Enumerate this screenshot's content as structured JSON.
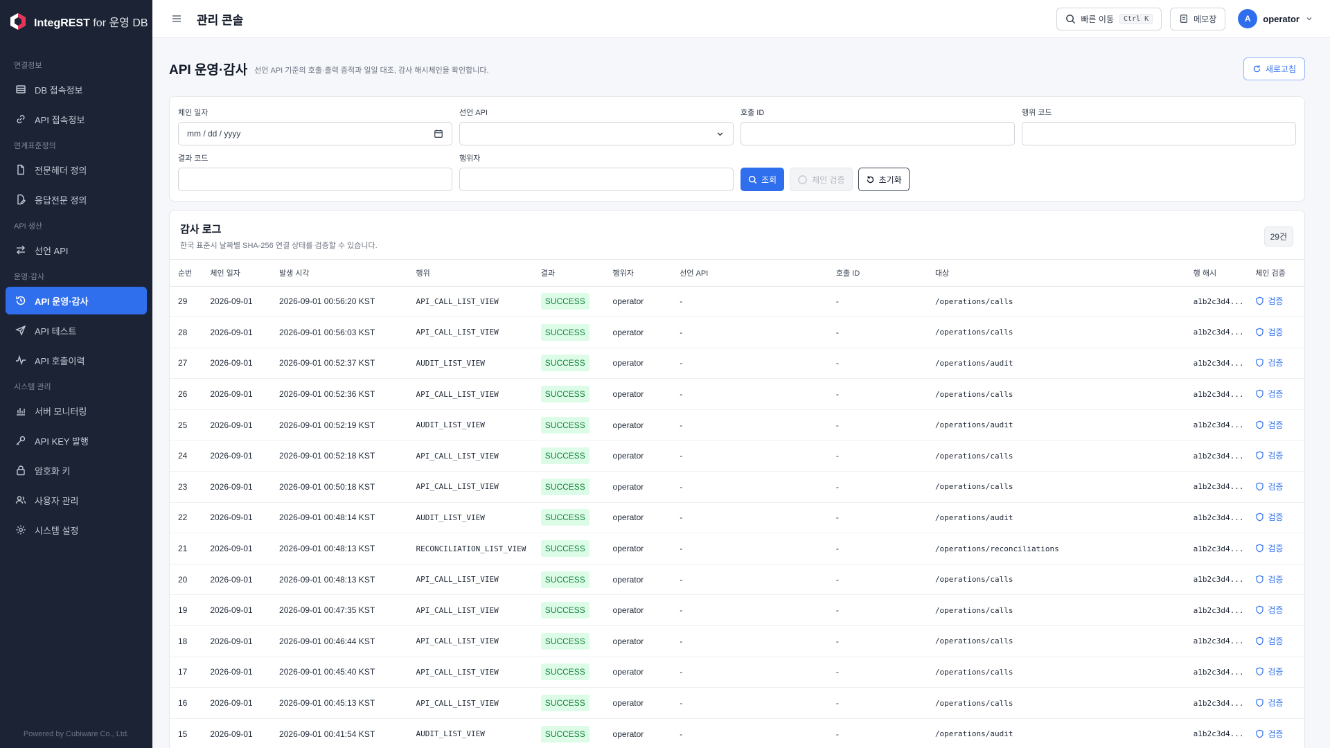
{
  "brand": {
    "name": "IntegREST",
    "suffix": "for 운영 DB"
  },
  "sidebar": {
    "sections": [
      {
        "title": "연결정보",
        "items": [
          {
            "label": "DB 접속정보",
            "icon": "database-icon"
          },
          {
            "label": "API 접속정보",
            "icon": "link-icon"
          }
        ]
      },
      {
        "title": "연계표준정의",
        "items": [
          {
            "label": "전문헤더 정의",
            "icon": "file-icon"
          },
          {
            "label": "응답전문 정의",
            "icon": "file-edit-icon"
          }
        ]
      },
      {
        "title": "API 생산",
        "items": [
          {
            "label": "선언 API",
            "icon": "arrows-icon"
          }
        ]
      },
      {
        "title": "운영·감사",
        "items": [
          {
            "label": "API 운영·감사",
            "icon": "history-icon",
            "active": true
          },
          {
            "label": "API 테스트",
            "icon": "send-icon"
          },
          {
            "label": "API 호출이력",
            "icon": "activity-icon"
          }
        ]
      },
      {
        "title": "시스템 관리",
        "items": [
          {
            "label": "서버 모니터링",
            "icon": "bar-chart-icon"
          },
          {
            "label": "API KEY 발행",
            "icon": "key-icon"
          },
          {
            "label": "암호화 키",
            "icon": "lock-icon"
          },
          {
            "label": "사용자 관리",
            "icon": "users-icon"
          },
          {
            "label": "시스템 설정",
            "icon": "gear-icon"
          }
        ]
      }
    ],
    "footer": "Powered by Cubiware Co., Ltd."
  },
  "topbar": {
    "title": "관리 콘솔",
    "quick_label": "빠른 이동",
    "quick_kbd": "Ctrl K",
    "memo_label": "메모장",
    "user_initial": "A",
    "user_name": "operator"
  },
  "page": {
    "title": "API 운영·감사",
    "subtitle": "선언 API 기준의 호출·출력 증적과 일일 대조, 감사 해시체인을 확인합니다.",
    "refresh_label": "새로고침"
  },
  "filters": {
    "chain_date_label": "체인 일자",
    "chain_date_placeholder": "mm / dd / yyyy",
    "api_label": "선언 API",
    "api_value": "",
    "call_id_label": "호출 ID",
    "action_code_label": "행위 코드",
    "result_code_label": "결과 코드",
    "actor_label": "행위자",
    "search_label": "조회",
    "verify_label": "체인 검증",
    "reset_label": "초기화"
  },
  "log": {
    "title": "감사 로그",
    "subtitle": "한국 표준시 날짜별 SHA-256 연결 상태를 검증할 수 있습니다.",
    "count": "29건",
    "columns": [
      "순번",
      "체인 일자",
      "발생 시각",
      "행위",
      "결과",
      "행위자",
      "선언 API",
      "호출 ID",
      "대상",
      "행 해시",
      "체인 검증"
    ],
    "verify_label": "검증",
    "rows": [
      {
        "seq": "29",
        "date": "2026-09-01",
        "time": "2026-09-01 00:56:20 KST",
        "action": "API_CALL_LIST_VIEW",
        "result": "SUCCESS",
        "actor": "operator",
        "api": "-",
        "call_id": "-",
        "target": "/operations/calls",
        "hash": "a1b2c3d4..."
      },
      {
        "seq": "28",
        "date": "2026-09-01",
        "time": "2026-09-01 00:56:03 KST",
        "action": "API_CALL_LIST_VIEW",
        "result": "SUCCESS",
        "actor": "operator",
        "api": "-",
        "call_id": "-",
        "target": "/operations/calls",
        "hash": "a1b2c3d4..."
      },
      {
        "seq": "27",
        "date": "2026-09-01",
        "time": "2026-09-01 00:52:37 KST",
        "action": "AUDIT_LIST_VIEW",
        "result": "SUCCESS",
        "actor": "operator",
        "api": "-",
        "call_id": "-",
        "target": "/operations/audit",
        "hash": "a1b2c3d4..."
      },
      {
        "seq": "26",
        "date": "2026-09-01",
        "time": "2026-09-01 00:52:36 KST",
        "action": "API_CALL_LIST_VIEW",
        "result": "SUCCESS",
        "actor": "operator",
        "api": "-",
        "call_id": "-",
        "target": "/operations/calls",
        "hash": "a1b2c3d4..."
      },
      {
        "seq": "25",
        "date": "2026-09-01",
        "time": "2026-09-01 00:52:19 KST",
        "action": "AUDIT_LIST_VIEW",
        "result": "SUCCESS",
        "actor": "operator",
        "api": "-",
        "call_id": "-",
        "target": "/operations/audit",
        "hash": "a1b2c3d4..."
      },
      {
        "seq": "24",
        "date": "2026-09-01",
        "time": "2026-09-01 00:52:18 KST",
        "action": "API_CALL_LIST_VIEW",
        "result": "SUCCESS",
        "actor": "operator",
        "api": "-",
        "call_id": "-",
        "target": "/operations/calls",
        "hash": "a1b2c3d4..."
      },
      {
        "seq": "23",
        "date": "2026-09-01",
        "time": "2026-09-01 00:50:18 KST",
        "action": "API_CALL_LIST_VIEW",
        "result": "SUCCESS",
        "actor": "operator",
        "api": "-",
        "call_id": "-",
        "target": "/operations/calls",
        "hash": "a1b2c3d4..."
      },
      {
        "seq": "22",
        "date": "2026-09-01",
        "time": "2026-09-01 00:48:14 KST",
        "action": "AUDIT_LIST_VIEW",
        "result": "SUCCESS",
        "actor": "operator",
        "api": "-",
        "call_id": "-",
        "target": "/operations/audit",
        "hash": "a1b2c3d4..."
      },
      {
        "seq": "21",
        "date": "2026-09-01",
        "time": "2026-09-01 00:48:13 KST",
        "action": "RECONCILIATION_LIST_VIEW",
        "result": "SUCCESS",
        "actor": "operator",
        "api": "-",
        "call_id": "-",
        "target": "/operations/reconciliations",
        "hash": "a1b2c3d4..."
      },
      {
        "seq": "20",
        "date": "2026-09-01",
        "time": "2026-09-01 00:48:13 KST",
        "action": "API_CALL_LIST_VIEW",
        "result": "SUCCESS",
        "actor": "operator",
        "api": "-",
        "call_id": "-",
        "target": "/operations/calls",
        "hash": "a1b2c3d4..."
      },
      {
        "seq": "19",
        "date": "2026-09-01",
        "time": "2026-09-01 00:47:35 KST",
        "action": "API_CALL_LIST_VIEW",
        "result": "SUCCESS",
        "actor": "operator",
        "api": "-",
        "call_id": "-",
        "target": "/operations/calls",
        "hash": "a1b2c3d4..."
      },
      {
        "seq": "18",
        "date": "2026-09-01",
        "time": "2026-09-01 00:46:44 KST",
        "action": "API_CALL_LIST_VIEW",
        "result": "SUCCESS",
        "actor": "operator",
        "api": "-",
        "call_id": "-",
        "target": "/operations/calls",
        "hash": "a1b2c3d4..."
      },
      {
        "seq": "17",
        "date": "2026-09-01",
        "time": "2026-09-01 00:45:40 KST",
        "action": "API_CALL_LIST_VIEW",
        "result": "SUCCESS",
        "actor": "operator",
        "api": "-",
        "call_id": "-",
        "target": "/operations/calls",
        "hash": "a1b2c3d4..."
      },
      {
        "seq": "16",
        "date": "2026-09-01",
        "time": "2026-09-01 00:45:13 KST",
        "action": "API_CALL_LIST_VIEW",
        "result": "SUCCESS",
        "actor": "operator",
        "api": "-",
        "call_id": "-",
        "target": "/operations/calls",
        "hash": "a1b2c3d4..."
      },
      {
        "seq": "15",
        "date": "2026-09-01",
        "time": "2026-09-01 00:41:54 KST",
        "action": "AUDIT_LIST_VIEW",
        "result": "SUCCESS",
        "actor": "operator",
        "api": "-",
        "call_id": "-",
        "target": "/operations/audit",
        "hash": "a1b2c3d4..."
      }
    ]
  },
  "colors": {
    "sidebar_bg": "#1b2334",
    "accent": "#2f6fed",
    "success_bg": "#dcfce7",
    "success_fg": "#15803d"
  }
}
